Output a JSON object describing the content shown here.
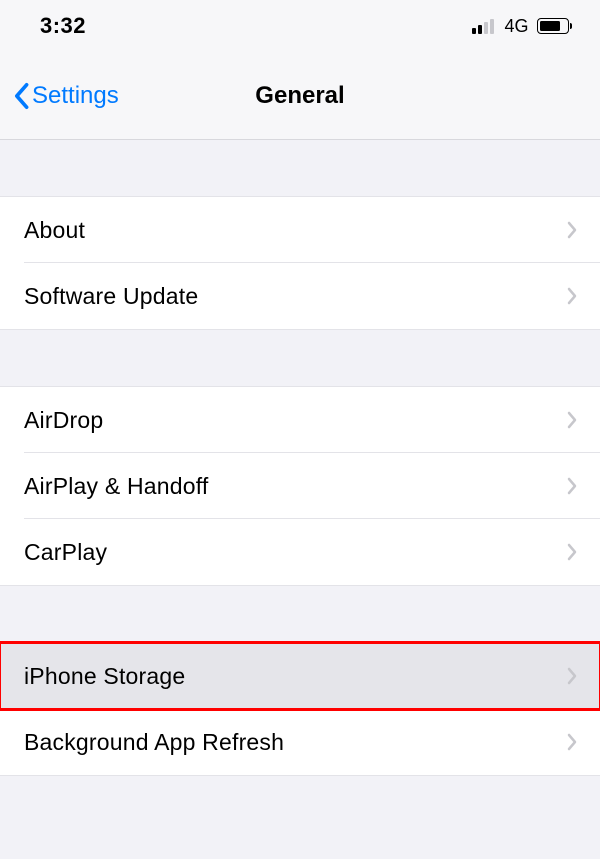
{
  "statusBar": {
    "time": "3:32",
    "network": "4G"
  },
  "nav": {
    "backLabel": "Settings",
    "title": "General"
  },
  "groups": [
    {
      "items": [
        {
          "label": "About"
        },
        {
          "label": "Software Update"
        }
      ]
    },
    {
      "items": [
        {
          "label": "AirDrop"
        },
        {
          "label": "AirPlay & Handoff"
        },
        {
          "label": "CarPlay"
        }
      ]
    },
    {
      "items": [
        {
          "label": "iPhone Storage",
          "highlighted": true
        },
        {
          "label": "Background App Refresh"
        }
      ]
    }
  ]
}
